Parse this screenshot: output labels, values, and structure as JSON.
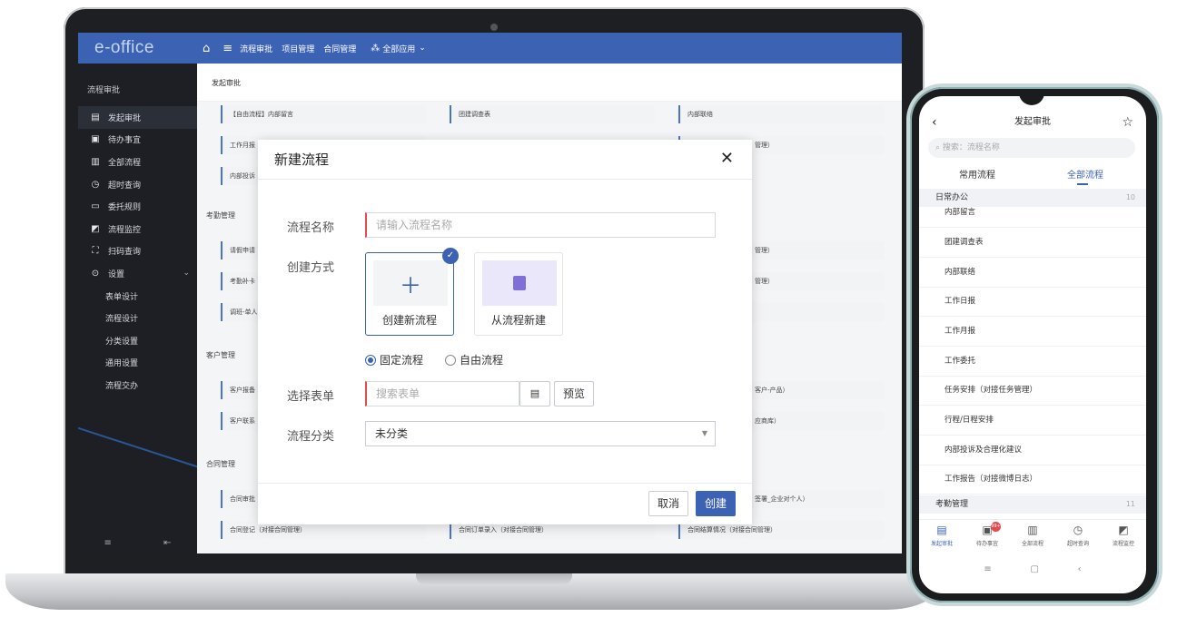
{
  "laptop": {
    "topbar": {
      "logo": "e-office",
      "items": [
        "流程审批",
        "项目管理",
        "合同管理",
        "全部应用"
      ]
    },
    "sidebar": {
      "title": "流程审批",
      "items": [
        {
          "label": "发起审批",
          "icon": "edit-icon"
        },
        {
          "label": "待办事宜",
          "icon": "todo-icon"
        },
        {
          "label": "全部流程",
          "icon": "list-icon"
        },
        {
          "label": "超时查询",
          "icon": "clock-search-icon"
        },
        {
          "label": "委托规则",
          "icon": "delegate-icon"
        },
        {
          "label": "流程监控",
          "icon": "monitor-icon"
        },
        {
          "label": "扫码查询",
          "icon": "scan-icon"
        },
        {
          "label": "设置",
          "icon": "settings-icon"
        }
      ],
      "sub_items": [
        "表单设计",
        "流程设计",
        "分类设置",
        "通用设置",
        "流程交办"
      ]
    },
    "main": {
      "breadcrumb": "发起审批",
      "sections": [
        "考勤管理",
        "客户管理",
        "合同管理"
      ],
      "flows": {
        "r1": [
          "【自由流程】内部留言",
          "团建调查表",
          "内部联络"
        ],
        "r2": [
          "工作月报",
          "管理）"
        ],
        "r3": [
          "内部投诉"
        ],
        "att1": [
          "请假申请",
          "管理）"
        ],
        "att2": [
          "考勤补卡",
          "管理）"
        ],
        "att3": [
          "调班-单人"
        ],
        "cus1": [
          "客户报备",
          "客户-产品）"
        ],
        "cus2": [
          "客户联系",
          "应商库）"
        ],
        "con1": [
          "合同审批",
          "签署_企业对个人）"
        ],
        "con2": [
          "合同登记（对接合同管理）",
          "合同订单录入（对接合同管理）",
          "合同结算情况（对接合同管理）"
        ]
      }
    },
    "dialog": {
      "title": "新建流程",
      "name_label": "流程名称",
      "name_placeholder": "请输入流程名称",
      "method_label": "创建方式",
      "option_new": "创建新流程",
      "option_copy": "从流程新建",
      "radio_fixed": "固定流程",
      "radio_free": "自由流程",
      "form_label": "选择表单",
      "form_placeholder": "搜索表单",
      "preview": "预览",
      "category_label": "流程分类",
      "category_value": "未分类",
      "cancel": "取消",
      "create": "创建"
    }
  },
  "phone": {
    "title": "发起审批",
    "search_placeholder": "搜索：流程名称",
    "tabs": [
      "常用流程",
      "全部流程"
    ],
    "groups": [
      {
        "name": "日常办公",
        "count": "10"
      },
      {
        "name": "考勤管理",
        "count": "11"
      }
    ],
    "items": [
      "内部留言",
      "团建调查表",
      "内部联络",
      "工作日报",
      "工作月报",
      "工作委托",
      "任务安排（对接任务管理）",
      "行程/日程安排",
      "内部投诉及合理化建议",
      "工作报告（对接微博日志）"
    ],
    "nav": [
      {
        "label": "发起审批",
        "icon": "edit-icon"
      },
      {
        "label": "待办事宜",
        "icon": "todo-icon",
        "badge": "99+"
      },
      {
        "label": "全部流程",
        "icon": "list-icon"
      },
      {
        "label": "超时查询",
        "icon": "clock-search-icon"
      },
      {
        "label": "流程监控",
        "icon": "monitor-icon"
      }
    ]
  },
  "colors": {
    "brand": "#3c62b4",
    "sidebar_bg": "#1d1f24",
    "required": "#e34c4c"
  }
}
